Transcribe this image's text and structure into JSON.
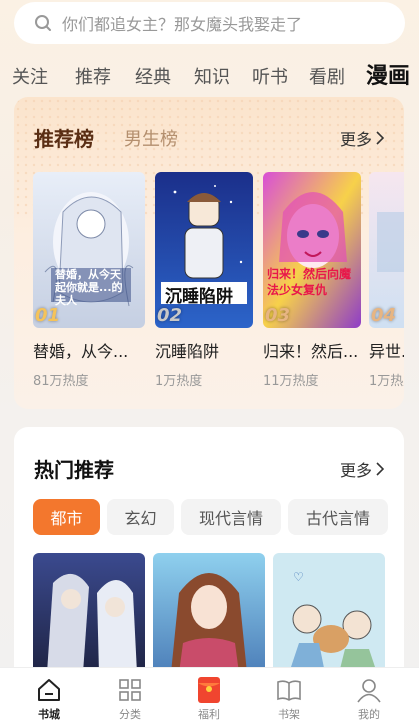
{
  "search": {
    "placeholder": "你们都追女主？那女魔头我娶走了",
    "icon": "search-icon"
  },
  "tabs": [
    {
      "label": "关注",
      "active": false
    },
    {
      "label": "推荐",
      "active": false
    },
    {
      "label": "经典",
      "active": false
    },
    {
      "label": "知识",
      "active": false
    },
    {
      "label": "听书",
      "active": false
    },
    {
      "label": "看剧",
      "active": false
    },
    {
      "label": "漫画",
      "active": true
    }
  ],
  "ranking": {
    "title": "推荐榜",
    "alt_title": "男生榜",
    "more": "更多",
    "books": [
      {
        "rank": "01",
        "title": "替婚，从今...",
        "heat": "81万热度",
        "cover_text": "替婚，从今天起你就是...的夫人"
      },
      {
        "rank": "02",
        "title": "沉睡陷阱",
        "heat": "1万热度",
        "cover_text": "沉睡陷阱"
      },
      {
        "rank": "03",
        "title": "归来！然后...",
        "heat": "11万热度",
        "cover_text": "归来！然后向魔法少女复仇"
      },
      {
        "rank": "04",
        "title": "异世...",
        "heat": "1万热度",
        "cover_text": ""
      }
    ]
  },
  "hot": {
    "title": "热门推荐",
    "more": "更多",
    "chips": [
      {
        "label": "都市",
        "active": true
      },
      {
        "label": "玄幻",
        "active": false
      },
      {
        "label": "现代言情",
        "active": false
      },
      {
        "label": "古代言情",
        "active": false
      }
    ]
  },
  "nav": [
    {
      "label": "书城",
      "icon": "home-icon",
      "active": true
    },
    {
      "label": "分类",
      "icon": "grid-icon",
      "active": false
    },
    {
      "label": "福利",
      "icon": "red-packet-icon",
      "active": false
    },
    {
      "label": "书架",
      "icon": "book-icon",
      "active": false
    },
    {
      "label": "我的",
      "icon": "user-icon",
      "active": false
    }
  ],
  "colors": {
    "accent": "#f3772d",
    "rank_title": "#5a2e14"
  }
}
